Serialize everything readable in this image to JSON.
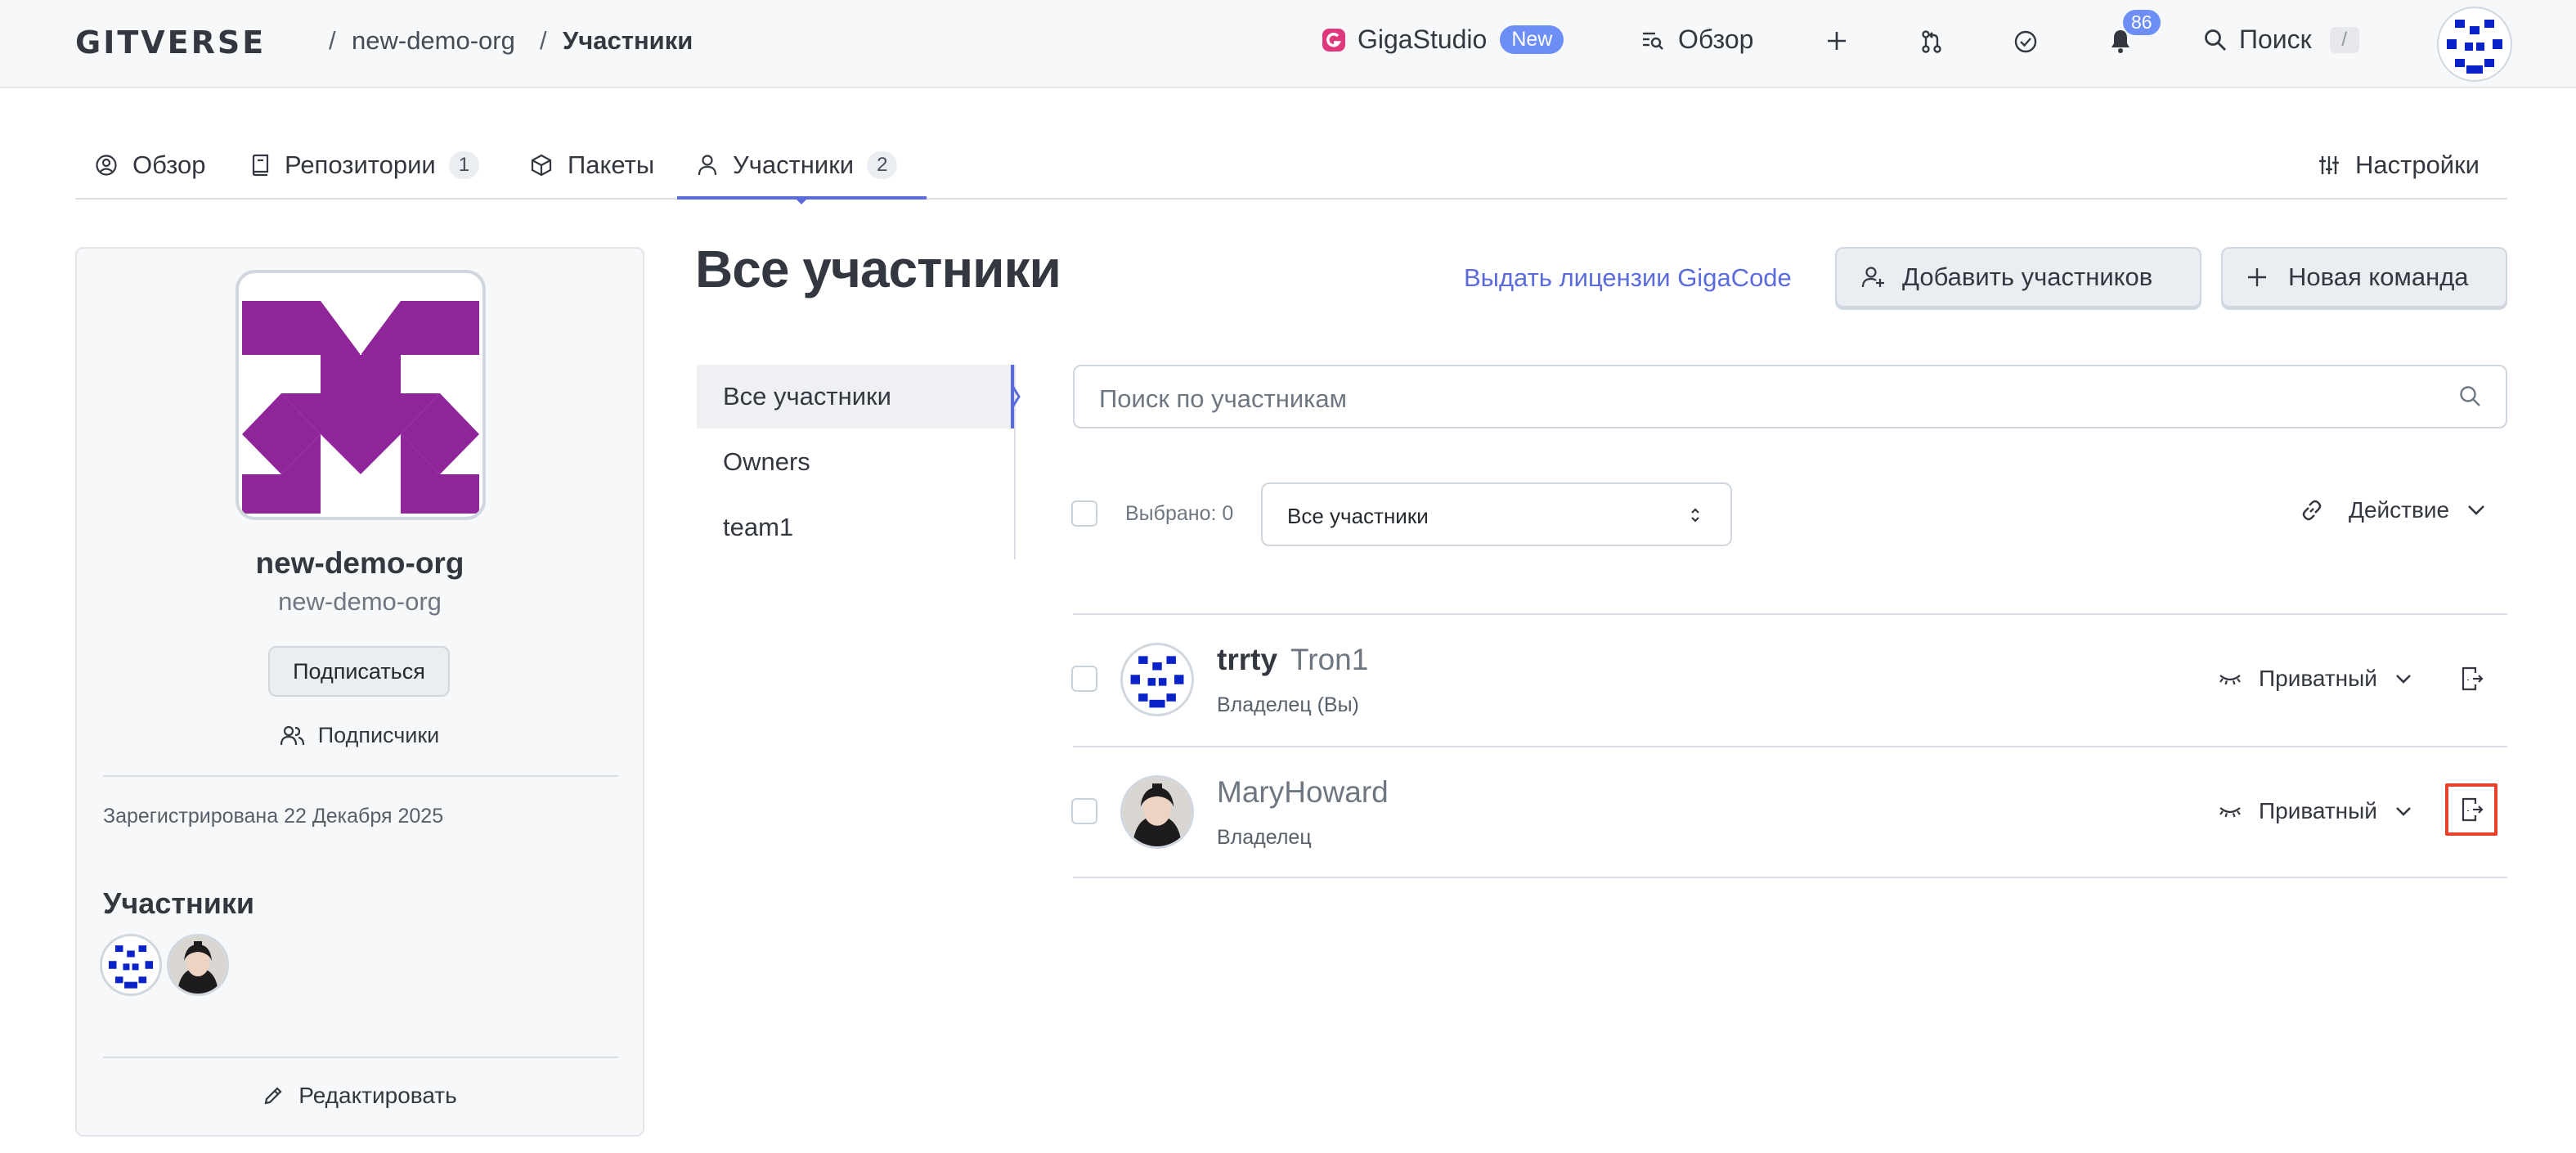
{
  "header": {
    "logo": "GITVERSE",
    "breadcrumb": {
      "org": "new-demo-org",
      "sep": "/",
      "current": "Участники"
    },
    "gigastudio": "GigaStudio",
    "gigastudio_badge": "New",
    "overview": "Обзор",
    "notifications_count": "86",
    "search": "Поиск",
    "search_shortcut": "/"
  },
  "tabs": [
    {
      "label": "Обзор",
      "icon": "user-circle-icon"
    },
    {
      "label": "Репозитории",
      "count": "1",
      "icon": "book-icon"
    },
    {
      "label": "Пакеты",
      "icon": "package-icon"
    },
    {
      "label": "Участники",
      "count": "2",
      "icon": "person-icon",
      "active": true
    }
  ],
  "settings_tab": "Настройки",
  "profile": {
    "name": "new-demo-org",
    "slug": "new-demo-org",
    "subscribe": "Подписаться",
    "followers": "Подписчики",
    "registered": "Зарегистрирована 22 Декабря 2025",
    "members_title": "Участники",
    "edit": "Редактировать"
  },
  "main": {
    "title": "Все участники",
    "license_link": "Выдать лицензии GigaCode",
    "add_members": "Добавить участников",
    "new_team": "Новая команда",
    "subnav": [
      "Все участники",
      "Owners",
      "team1"
    ],
    "search_placeholder": "Поиск по участникам",
    "selected": "Выбрано: 0",
    "filter_value": "Все участники",
    "action": "Действие",
    "members": [
      {
        "login": "trrty",
        "full_name": "Tron1",
        "role": "Владелец (Вы)",
        "visibility": "Приватный"
      },
      {
        "login": "MaryHoward",
        "full_name": "",
        "role": "Владелец",
        "visibility": "Приватный"
      }
    ]
  },
  "colors": {
    "accent": "#5b6bdb",
    "badge": "#6c8ef5",
    "org_identicon": "#8e2599",
    "user_identicon": "#0a23c8",
    "highlight": "#e8412b"
  }
}
